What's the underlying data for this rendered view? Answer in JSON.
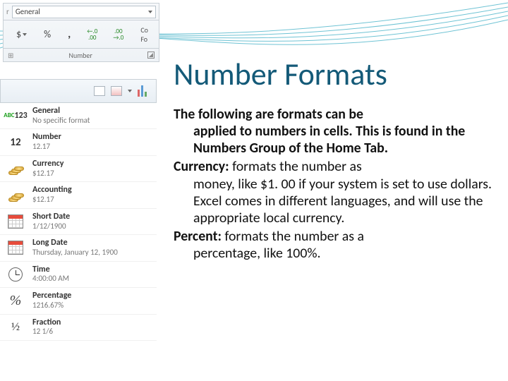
{
  "ribbon": {
    "dropdown_value": "General",
    "group_label": "Number",
    "cond_prefix": "Co",
    "cond_suffix": "Fo",
    "currency_sym": "$",
    "percent_sym": "%",
    "comma_sym": ",",
    "dec_inc_a": ".0",
    "dec_inc_b": ".00",
    "dec_dec_a": ".00",
    "dec_dec_b": ".0",
    "left_edge": "r"
  },
  "formats": [
    {
      "id": "general",
      "name": "General",
      "sample": "No specific format"
    },
    {
      "id": "number",
      "name": "Number",
      "sample": "12.17"
    },
    {
      "id": "currency",
      "name": "Currency",
      "sample": "$12.17"
    },
    {
      "id": "accounting",
      "name": "Accounting",
      "sample": "$12.17"
    },
    {
      "id": "shortdate",
      "name": "Short Date",
      "sample": "1/12/1900"
    },
    {
      "id": "longdate",
      "name": "Long Date",
      "sample": "Thursday, January 12, 1900"
    },
    {
      "id": "time",
      "name": "Time",
      "sample": "4:00:00 AM"
    },
    {
      "id": "percentage",
      "name": "Percentage",
      "sample": "1216.67%"
    },
    {
      "id": "fraction",
      "name": "Fraction",
      "sample": "12 1/6"
    }
  ],
  "slide": {
    "title": "Number Formats",
    "intro_lead": "The following are formats can be ",
    "intro_rest": "applied to numbers in cells.  This is found in the Numbers Group of the Home Tab.",
    "currency_label": "Currency:",
    "currency_lead": " formats the number as ",
    "currency_rest": "money, like $1. 00 if your system is set to use dollars. Excel comes in different languages, and will use the appropriate local currency.",
    "percent_label": "Percent:",
    "percent_lead": " formats the number as a ",
    "percent_rest": "percentage, like 100%."
  }
}
